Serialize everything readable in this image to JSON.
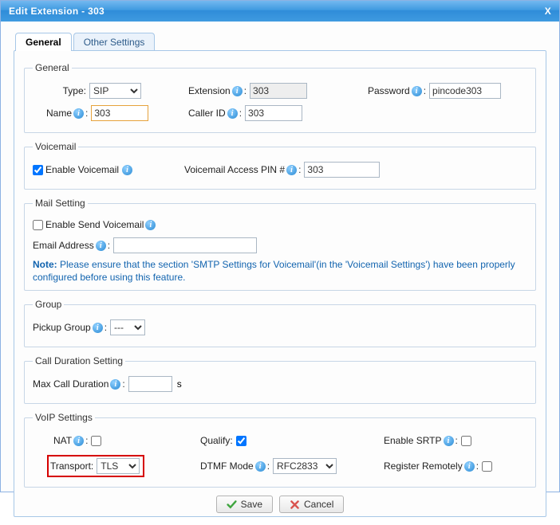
{
  "window": {
    "title": "Edit Extension - 303",
    "close": "X"
  },
  "tabs": {
    "general": "General",
    "other": "Other Settings"
  },
  "general": {
    "legend": "General",
    "type_label": "Type:",
    "type_value": "SIP",
    "extension_label": "Extension",
    "extension_value": "303",
    "password_label": "Password",
    "password_value": "pincode303",
    "name_label": "Name",
    "name_value": "303",
    "callerid_label": "Caller ID",
    "callerid_value": "303"
  },
  "voicemail": {
    "legend": "Voicemail",
    "enable_label": "Enable Voicemail",
    "pin_label": "Voicemail Access PIN #",
    "pin_value": "303"
  },
  "mail": {
    "legend": "Mail Setting",
    "enable_label": "Enable Send Voicemail",
    "email_label": "Email Address",
    "email_value": "",
    "note_prefix": "Note:",
    "note_text": " Please ensure that the section 'SMTP Settings for Voicemail'(in the 'Voicemail Settings') have been properly configured before using this feature."
  },
  "group": {
    "legend": "Group",
    "pickup_label": "Pickup Group",
    "pickup_value": "---"
  },
  "calldur": {
    "legend": "Call Duration Setting",
    "max_label": "Max Call Duration",
    "max_value": "",
    "unit": "s"
  },
  "voip": {
    "legend": "VoIP Settings",
    "nat_label": "NAT",
    "qualify_label": "Qualify:",
    "srtp_label": "Enable SRTP",
    "transport_label": "Transport:",
    "transport_value": "TLS",
    "dtmf_label": "DTMF Mode",
    "dtmf_value": "RFC2833",
    "register_label": "Register Remotely"
  },
  "buttons": {
    "save": "Save",
    "cancel": "Cancel"
  }
}
